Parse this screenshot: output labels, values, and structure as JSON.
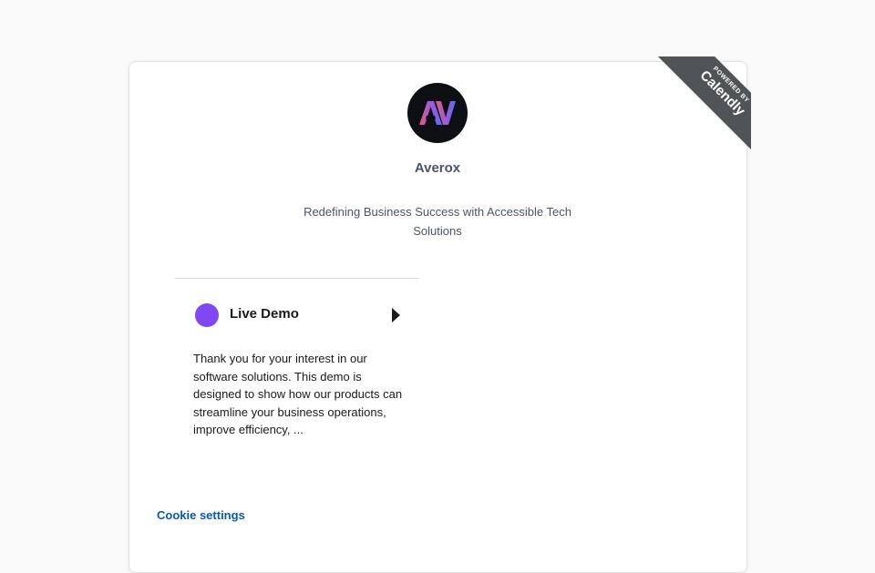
{
  "ribbon": {
    "small_text": "POWERED BY",
    "brand_text": "Calendly"
  },
  "organization": {
    "logo_text": "AV",
    "name": "Averox",
    "tagline": "Redefining Business Success with Accessible Tech Solutions"
  },
  "event": {
    "title": "Live Demo",
    "color": "#8247f5",
    "description": "Thank you for your interest in our software solutions. This demo is designed to show how our products can streamline your business operations, improve efficiency, ..."
  },
  "footer": {
    "cookie_label": "Cookie settings"
  },
  "colors": {
    "background": "#fafafa",
    "card": "#ffffff",
    "ribbon": "#505457",
    "link": "#0a57b3",
    "muted_text": "#4a5568"
  }
}
